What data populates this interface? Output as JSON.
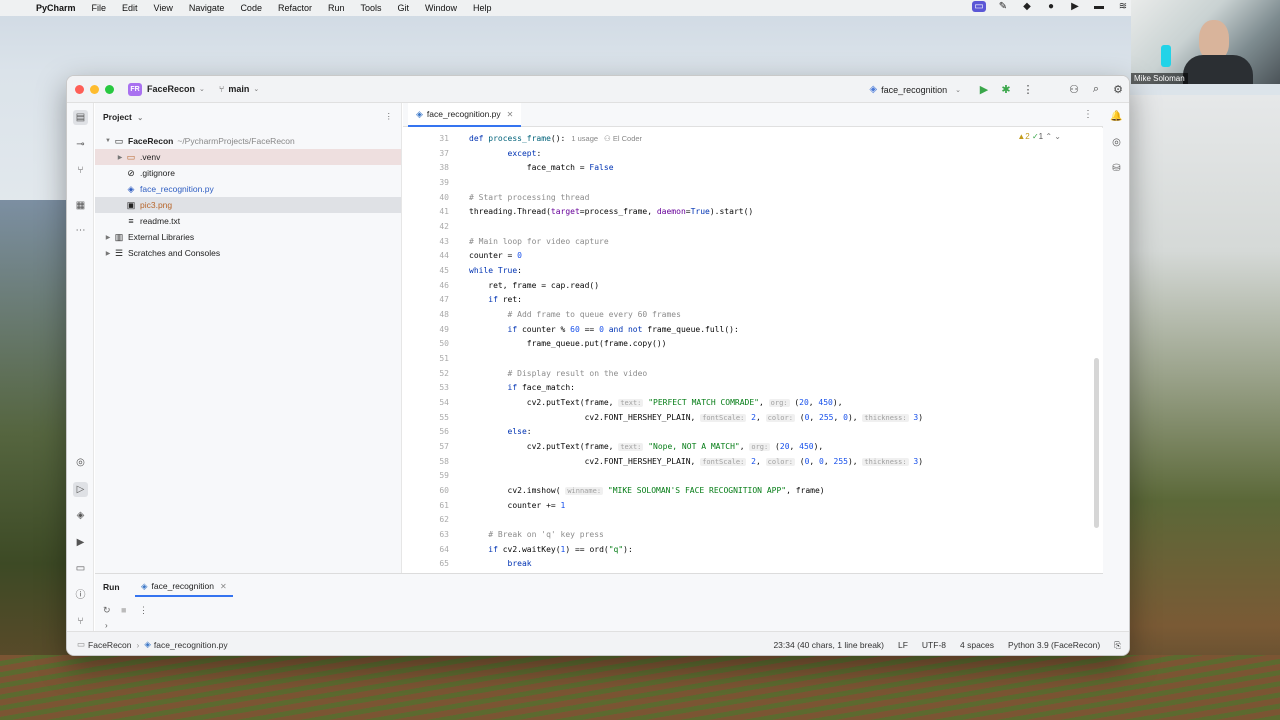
{
  "menubar": {
    "app": "PyCharm",
    "items": [
      "File",
      "Edit",
      "View",
      "Navigate",
      "Code",
      "Refactor",
      "Run",
      "Tools",
      "Git",
      "Window",
      "Help"
    ]
  },
  "webcam": {
    "name": "Mike Soloman"
  },
  "titlebar": {
    "project_badge": "FR",
    "project_name": "FaceRecon",
    "branch": "main",
    "run_config": "face_recognition"
  },
  "project_panel": {
    "title": "Project",
    "tree": [
      {
        "label": "FaceRecon",
        "path": "~/PycharmProjects/FaceRecon"
      },
      {
        "label": ".venv"
      },
      {
        "label": ".gitignore"
      },
      {
        "label": "face_recognition.py"
      },
      {
        "label": "pic3.png"
      },
      {
        "label": "readme.txt"
      },
      {
        "label": "External Libraries"
      },
      {
        "label": "Scratches and Consoles"
      }
    ]
  },
  "editor": {
    "tab": "face_recognition.py",
    "usage": "1 usage",
    "author": "El Coder",
    "warnings": "2",
    "checks": "1",
    "line_numbers": [
      "31",
      "37",
      "38",
      "39",
      "40",
      "41",
      "42",
      "43",
      "44",
      "45",
      "46",
      "47",
      "48",
      "49",
      "50",
      "51",
      "52",
      "53",
      "54",
      "55",
      "56",
      "57",
      "58",
      "59",
      "60",
      "61",
      "62",
      "63",
      "64",
      "65"
    ]
  },
  "run_panel": {
    "label": "Run",
    "tab": "face_recognition"
  },
  "statusbar": {
    "project": "FaceRecon",
    "file": "face_recognition.py",
    "position": "23:34 (40 chars, 1 line break)",
    "line_sep": "LF",
    "encoding": "UTF-8",
    "indent": "4 spaces",
    "interpreter": "Python 3.9 (FaceRecon)"
  }
}
